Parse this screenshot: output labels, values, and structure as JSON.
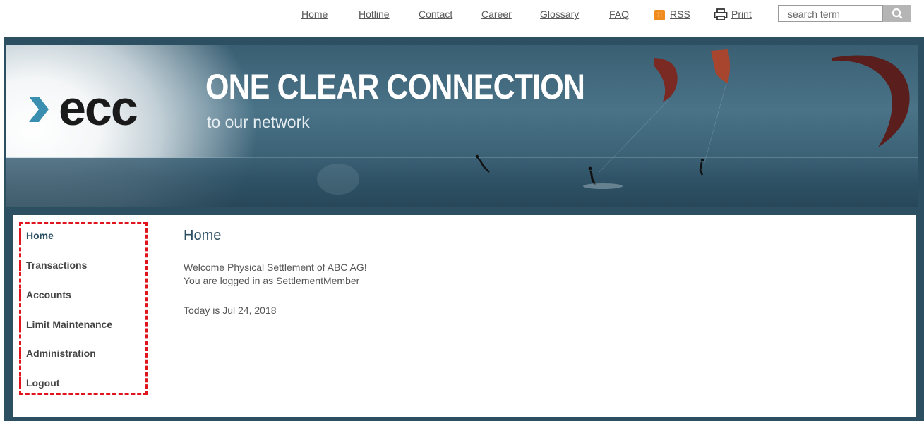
{
  "topnav": {
    "links": [
      "Home",
      "Hotline",
      "Contact",
      "Career",
      "Glossary",
      "FAQ"
    ],
    "rss_label": "RSS",
    "print_label": "Print"
  },
  "search": {
    "placeholder": "search term"
  },
  "banner": {
    "logo_text": "ecc",
    "headline": "ONE CLEAR CONNECTION",
    "subheadline": "to our network"
  },
  "sidebar": {
    "items": [
      {
        "label": "Home",
        "active": true
      },
      {
        "label": "Transactions",
        "active": false
      },
      {
        "label": "Accounts",
        "active": false
      },
      {
        "label": "Limit Maintenance",
        "active": false
      },
      {
        "label": "Administration",
        "active": false
      },
      {
        "label": "Logout",
        "active": false
      }
    ]
  },
  "main": {
    "title": "Home",
    "welcome": "Welcome Physical Settlement of ABC AG!",
    "logged_in": "You are logged in as SettlementMember",
    "today": "Today is Jul 24, 2018"
  },
  "colors": {
    "brand_dark": "#2c4f62",
    "accent_red": "#e0141c",
    "chevron_blue": "#3a8fb0",
    "rss_orange": "#f08c1e"
  }
}
